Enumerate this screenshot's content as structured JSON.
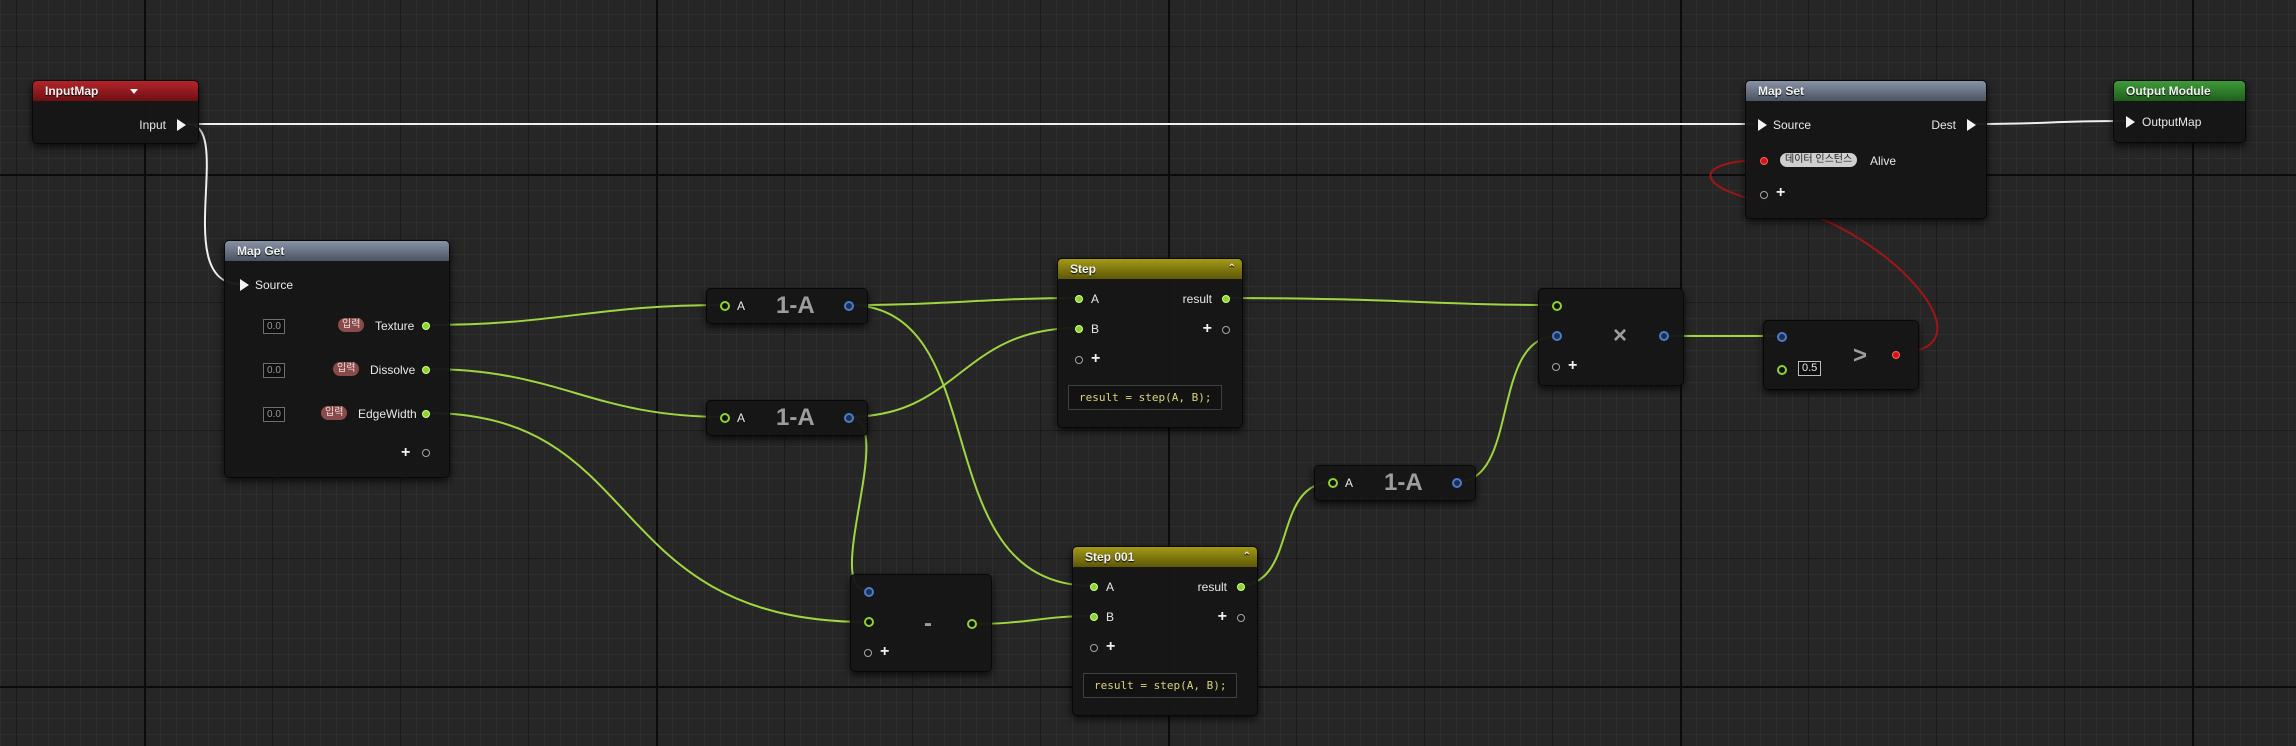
{
  "canvas": {
    "type": "niagara-module-graph"
  },
  "nodes": {
    "input_map": {
      "title": "InputMap",
      "output_pin": "Input"
    },
    "map_get": {
      "title": "Map Get",
      "input_pin": "Source",
      "outputs": [
        {
          "value": "0.0",
          "badge": "입력",
          "label": "Texture"
        },
        {
          "value": "0.0",
          "badge": "입력",
          "label": "Dissolve"
        },
        {
          "value": "0.0",
          "badge": "입력",
          "label": "EdgeWidth"
        }
      ]
    },
    "one_minus_1": {
      "input_pin": "A",
      "symbol": "1-A"
    },
    "one_minus_2": {
      "input_pin": "A",
      "symbol": "1-A"
    },
    "one_minus_3": {
      "input_pin": "A",
      "symbol": "1-A"
    },
    "subtract": {
      "symbol": "-"
    },
    "step": {
      "title": "Step",
      "input_a": "A",
      "input_b": "B",
      "output": "result",
      "code": "result = step(A, B);"
    },
    "step_001": {
      "title": "Step 001",
      "input_a": "A",
      "input_b": "B",
      "output": "result",
      "code": "result = step(A, B);"
    },
    "multiply": {
      "symbol": "×"
    },
    "greater": {
      "symbol": ">",
      "value": "0.5"
    },
    "map_set": {
      "title": "Map Set",
      "input_pin": "Source",
      "output_pin": "Dest",
      "param_badge": "데이터 인스턴스",
      "param_label": "Alive"
    },
    "output_module": {
      "title": "Output Module",
      "input_pin": "OutputMap"
    }
  },
  "colors": {
    "exec_wire": "#f0f0f0",
    "float_wire": "#9fd640",
    "bool_wire": "#a01616",
    "header_red": "#a32226",
    "header_green": "#3a8f36",
    "header_gray": "#7a8597",
    "header_olive": "#968d12"
  }
}
